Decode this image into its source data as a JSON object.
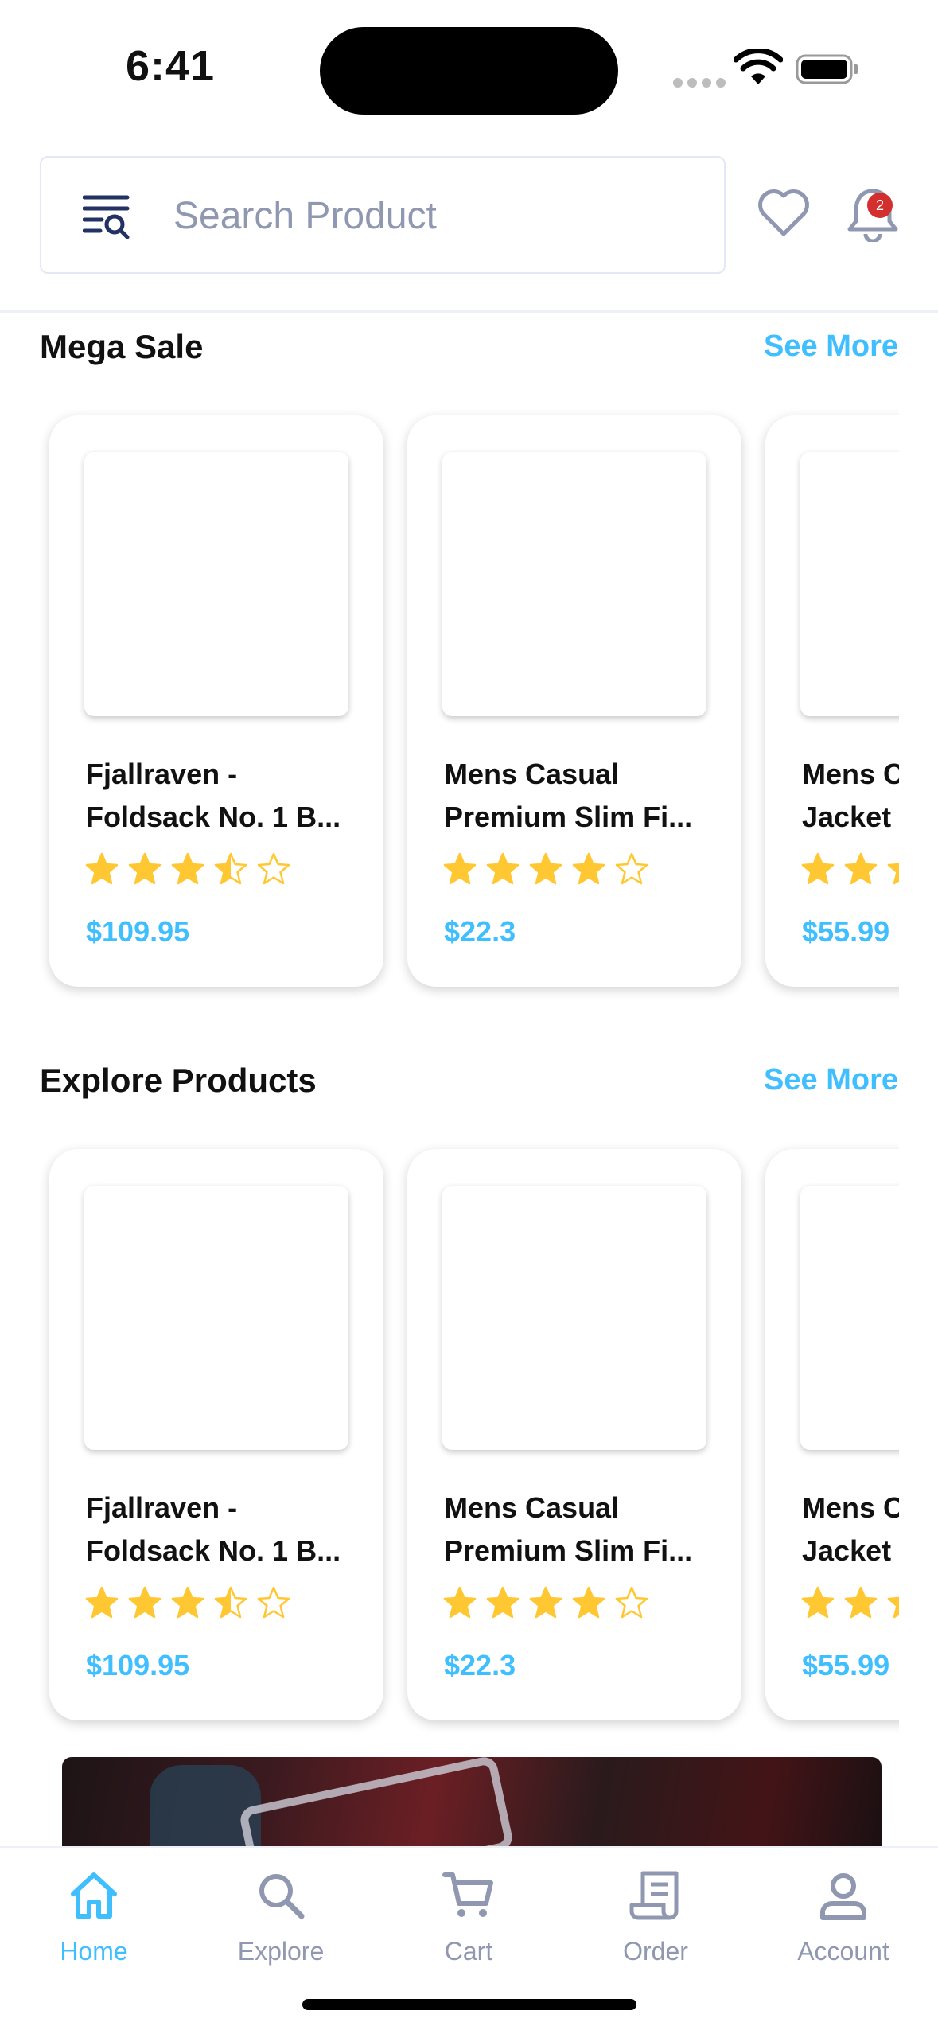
{
  "status_bar": {
    "time": "6:41"
  },
  "header": {
    "search_placeholder": "Search Product",
    "notification_count": "2"
  },
  "sections": [
    {
      "title": "Mega Sale",
      "see_more": "See More",
      "products": [
        {
          "name": "Fjallraven -\nFoldsack No. 1 B...",
          "rating": 3.5,
          "price": "$109.95"
        },
        {
          "name": "Mens Casual\nPremium Slim Fi...",
          "rating": 4,
          "price": "$22.3"
        },
        {
          "name": "Mens C\nJacket",
          "rating": 2.5,
          "price": "$55.99"
        }
      ]
    },
    {
      "title": "Explore Products",
      "see_more": "See More",
      "products": [
        {
          "name": "Fjallraven -\nFoldsack No. 1 B...",
          "rating": 3.5,
          "price": "$109.95"
        },
        {
          "name": "Mens Casual\nPremium Slim Fi...",
          "rating": 4,
          "price": "$22.3"
        },
        {
          "name": "Mens C\nJacket",
          "rating": 2.5,
          "price": "$55.99"
        }
      ]
    }
  ],
  "bottom_nav": [
    {
      "label": "Home",
      "icon": "home-icon",
      "active": true
    },
    {
      "label": "Explore",
      "icon": "search-icon",
      "active": false
    },
    {
      "label": "Cart",
      "icon": "cart-icon",
      "active": false
    },
    {
      "label": "Order",
      "icon": "order-icon",
      "active": false
    },
    {
      "label": "Account",
      "icon": "account-icon",
      "active": false
    }
  ],
  "colors": {
    "accent": "#40bfff",
    "star": "#ffc833",
    "muted": "#9098b1",
    "badge": "#d32f2f"
  }
}
